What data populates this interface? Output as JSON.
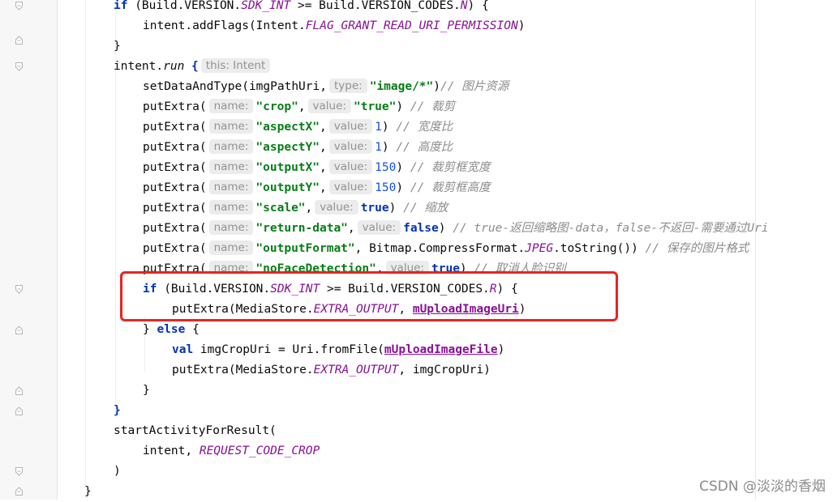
{
  "code": {
    "l1": {
      "kw_if": "if",
      "a": " (Build.VERSION.",
      "sdk": "SDK_INT",
      "b": " >= Build.VERSION_CODES.",
      "n": "N",
      "c": ") {"
    },
    "l2": {
      "a": "intent.addFlags(Intent.",
      "flag": "FLAG_GRANT_READ_URI_PERMISSION",
      "c": ")"
    },
    "l3": {
      "a": "}"
    },
    "l4": {
      "a": "intent.",
      "run": "run",
      "b": " {",
      "hint": "this: Intent"
    },
    "l5": {
      "a": "setDataAndType(imgPathUri,",
      "hint": "type:",
      "s": "\"image/*\"",
      "c": ")",
      "cm": "// 图片资源"
    },
    "l6": {
      "a": "putExtra(",
      "hint": "name:",
      "s": "\"crop\"",
      "comma": ",",
      "hint2": "value:",
      "v": "\"true\"",
      "c": ")",
      "cm": "// 裁剪"
    },
    "l7": {
      "a": "putExtra(",
      "hint": "name:",
      "s": "\"aspectX\"",
      "comma": ",",
      "hint2": "value:",
      "v": "1",
      "c": ")",
      "cm": "// 宽度比"
    },
    "l8": {
      "a": "putExtra(",
      "hint": "name:",
      "s": "\"aspectY\"",
      "comma": ",",
      "hint2": "value:",
      "v": "1",
      "c": ")",
      "cm": "// 高度比"
    },
    "l9": {
      "a": "putExtra(",
      "hint": "name:",
      "s": "\"outputX\"",
      "comma": ",",
      "hint2": "value:",
      "v": "150",
      "c": ")",
      "cm": "// 裁剪框宽度"
    },
    "l10": {
      "a": "putExtra(",
      "hint": "name:",
      "s": "\"outputY\"",
      "comma": ",",
      "hint2": "value:",
      "v": "150",
      "c": ")",
      "cm": "// 裁剪框高度"
    },
    "l11": {
      "a": "putExtra(",
      "hint": "name:",
      "s": "\"scale\"",
      "comma": ",",
      "hint2": "value:",
      "v": "true",
      "c": ")",
      "cm": "// 缩放"
    },
    "l12": {
      "a": "putExtra(",
      "hint": "name:",
      "s": "\"return-data\"",
      "comma": ",",
      "hint2": "value:",
      "v": "false",
      "c": ")",
      "cm": "// true-返回缩略图-data，false-不返回-需要通过Uri"
    },
    "l13": {
      "a": "putExtra(",
      "hint": "name:",
      "s": "\"outputFormat\"",
      "b": ", Bitmap.CompressFormat.",
      "jpeg": "JPEG",
      "c": ".toString())",
      "cm": "// 保存的图片格式"
    },
    "l14": {
      "a": "putExtra(",
      "hint": "name:",
      "s": "\"noFaceDetection\"",
      "comma": ",",
      "hint2": "value:",
      "v": "true",
      "c": ")",
      "cm": "// 取消人脸识别"
    },
    "l15": {
      "kw_if": "if",
      "a": " (Build.VERSION.",
      "sdk": "SDK_INT",
      "b": " >= Build.VERSION_CODES.",
      "r": "R",
      "c": ") {"
    },
    "l16": {
      "a": "putExtra(MediaStore.",
      "eo": "EXTRA_OUTPUT",
      "b": ", ",
      "f": "mUploadImageUri",
      "c": ")"
    },
    "l17": {
      "a": "} ",
      "kw_else": "else",
      "c": " {"
    },
    "l18": {
      "kw_val": "val",
      "a": " imgCropUri = Uri.fromFile(",
      "f": "mUploadImageFile",
      "c": ")"
    },
    "l19": {
      "a": "putExtra(MediaStore.",
      "eo": "EXTRA_OUTPUT",
      "c": ", imgCropUri)"
    },
    "l20": {
      "a": "}"
    },
    "l21": {
      "a": "}"
    },
    "l22": {
      "a": "startActivityForResult("
    },
    "l23": {
      "a": "intent, ",
      "rc": "REQUEST_CODE_CROP"
    },
    "l24": {
      "a": ")"
    },
    "l25": {
      "a": "}"
    }
  },
  "watermark": "CSDN @淡淡的香烟",
  "colors": {
    "keyword": "#0033b3",
    "string": "#067d17",
    "number": "#1750eb",
    "constant": "#871094",
    "comment": "#8c8c8c",
    "highlight_border": "#e8251f"
  }
}
